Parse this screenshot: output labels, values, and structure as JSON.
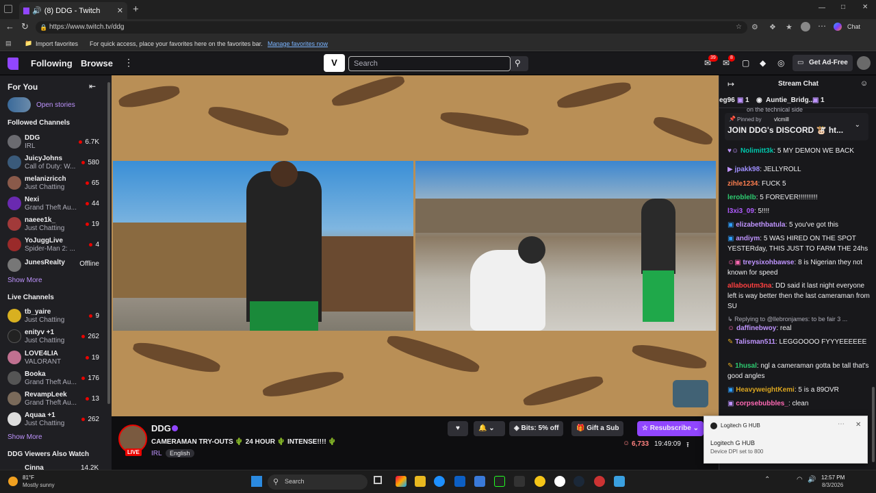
{
  "browser": {
    "tab_title": "(8) DDG - Twitch",
    "url": "https://www.twitch.tv/ddg",
    "import_favorites": "Import favorites",
    "fav_hint": "For quick access, place your favorites here on the favorites bar.",
    "manage_favorites": "Manage favorites now",
    "chat_label": "Chat"
  },
  "topnav": {
    "following": "Following",
    "browse": "Browse",
    "search_placeholder": "Search",
    "inbox_badge": "39",
    "whispers_badge": "8",
    "get_ad_free": "Get Ad-Free"
  },
  "sidebar": {
    "for_you": "For You",
    "open_stories": "Open stories",
    "followed_header": "Followed Channels",
    "followed": [
      {
        "name": "DDG",
        "game": "IRL",
        "viewers": "6.7K",
        "color": "#6b6b70"
      },
      {
        "name": "JuicyJohns",
        "game": "Call of Duty: W...",
        "viewers": "580",
        "color": "#3a5a7a"
      },
      {
        "name": "melanizricch",
        "game": "Just Chatting",
        "viewers": "65",
        "color": "#8a5a4a"
      },
      {
        "name": "Nexi",
        "game": "Grand Theft Au...",
        "viewers": "44",
        "color": "#6a2ab0"
      },
      {
        "name": "naeee1k_",
        "game": "Just Chatting",
        "viewers": "19",
        "color": "#a23a3a"
      },
      {
        "name": "YoJuggLive",
        "game": "Spider-Man 2: ...",
        "viewers": "4",
        "color": "#9a2a2a"
      },
      {
        "name": "JunesRealty",
        "game": "",
        "viewers": "Offline",
        "color": "#777"
      }
    ],
    "show_more_1": "Show More",
    "live_header": "Live Channels",
    "live": [
      {
        "name": "tb_yaire",
        "game": "Just Chatting",
        "viewers": "9",
        "color": "#d8b020"
      },
      {
        "name": "enityv +1",
        "game": "Just Chatting",
        "viewers": "262",
        "color": "#222"
      },
      {
        "name": "LOVE4LIA",
        "game": "VALORANT",
        "viewers": "19",
        "color": "#c07090"
      },
      {
        "name": "Booka",
        "game": "Grand Theft Au...",
        "viewers": "176",
        "color": "#555"
      },
      {
        "name": "RevampLeek",
        "game": "Grand Theft Au...",
        "viewers": "13",
        "color": "#7a6a5a"
      },
      {
        "name": "Aquaa +1",
        "game": "Just Chatting",
        "viewers": "262",
        "color": "#ddd"
      }
    ],
    "show_more_2": "Show More",
    "also_watch": "DDG Viewers Also Watch",
    "cut_name": "Cinna",
    "cut_viewers": "14.2K"
  },
  "stream": {
    "channel": "DDG",
    "title": "CAMERAMAN TRY-OUTS 🌵 24 HOUR 🌵 INTENSE!!!! 🌵",
    "category": "IRL",
    "tag": "English",
    "live": "LIVE",
    "viewers": "6,733",
    "uptime": "19:49:09",
    "bits": "Bits: 5% off",
    "gift": "Gift a Sub",
    "resub": "Resubscribe"
  },
  "chat": {
    "header": "Stream Chat",
    "gifter1": "eg96",
    "gifter1_count": "1",
    "gifter2": "Auntie_Bridg...",
    "gifter2_count": "1",
    "cutoff": "on the technical side",
    "pinned_by": "Pinned by",
    "pinned_user": "vlcmill",
    "pinned_text": "JOIN DDG's DISCORD 🐮 ht...",
    "messages": [
      {
        "user": "Nolimitt3k",
        "color": "#00c7ac",
        "text": "5 MY DEMON WE BACK"
      },
      {
        "user": "jpakk98",
        "color": "#9f8fff",
        "text": "JELLYROLL"
      },
      {
        "user": "zihle1234",
        "color": "#ff7f50",
        "text": "FUCK 5"
      },
      {
        "user": "leroblelb",
        "color": "#2ecc71",
        "text": "5 FOREVER!!!!!!!!!!"
      },
      {
        "user": "l3xi3_09",
        "color": "#b05cff",
        "text": "5!!!!"
      },
      {
        "user": "elizabethbatula",
        "color": "#bf94ff",
        "text": "5 you've got this"
      },
      {
        "user": "andiym",
        "color": "#bf94ff",
        "text": "5 WAS HIRED ON THE SPOT YESTERday, THIS JUST TO FARM THE 24hs"
      },
      {
        "user": "treysixohbawse",
        "color": "#bf94ff",
        "text": "8 is Nigerian they not known for speed"
      },
      {
        "user": "allaboutm3na",
        "color": "#ff4040",
        "text": "DD said it last night everyone left is way better then the last cameraman from SU"
      },
      {
        "user": "daffinebwoy",
        "color": "#bf94ff",
        "text": "real"
      },
      {
        "user": "Talisman511",
        "color": "#bf94ff",
        "text": "LEGGOOOO FYYYEEEEEE"
      },
      {
        "user": "1husal",
        "color": "#2ecc71",
        "text": "ngl a cameraman gotta be tall that's good angles"
      },
      {
        "user": "HeavyweightKemi",
        "color": "#daa520",
        "text": "5 is a 89OVR"
      },
      {
        "user": "corpsebubbles_",
        "color": "#ff69b4",
        "text": "clean"
      }
    ],
    "reply_text": "Replying to @llebronjames: to be fair 3 ..."
  },
  "toast": {
    "app": "Logitech G HUB",
    "title": "Logitech G HUB",
    "body": "Device DPI set to 800"
  },
  "taskbar": {
    "temp": "81°F",
    "weather": "Mostly sunny",
    "search": "Search",
    "time": "12:57 PM",
    "date": "8/3/2026"
  }
}
